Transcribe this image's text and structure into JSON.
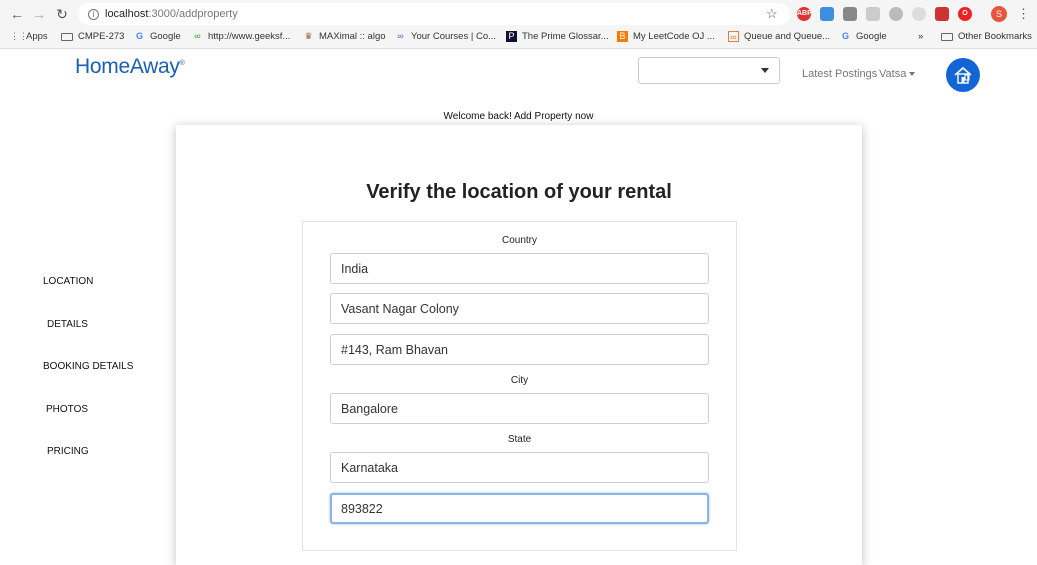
{
  "browser": {
    "url_host": "localhost",
    "url_path": ":3000/addproperty",
    "profile_initial": "S"
  },
  "bookmarks": [
    {
      "label": "Apps"
    },
    {
      "label": "CMPE-273"
    },
    {
      "label": "Google"
    },
    {
      "label": "http://www.geeksf..."
    },
    {
      "label": "MAXimal :: algo"
    },
    {
      "label": "Your Courses | Co..."
    },
    {
      "label": "The Prime Glossar..."
    },
    {
      "label": "My LeetCode OJ ..."
    },
    {
      "label": "Queue and Queue..."
    },
    {
      "label": "Google"
    },
    {
      "label": "Other Bookmarks"
    }
  ],
  "navbar": {
    "brand": "HomeAway",
    "brand_mark": "®",
    "select_value": "",
    "latest_postings": "Latest Postings",
    "user_name": "Vatsa"
  },
  "welcome": "Welcome back! Add Property now",
  "sidebar": {
    "items": [
      {
        "label": "LOCATION"
      },
      {
        "label": "DETAILS"
      },
      {
        "label": "BOOKING DETAILS"
      },
      {
        "label": "PHOTOS"
      },
      {
        "label": "PRICING"
      }
    ]
  },
  "form": {
    "title": "Verify the location of your rental",
    "country_label": "Country",
    "country": "India",
    "street": "Vasant Nagar Colony",
    "unit": "#143, Ram Bhavan",
    "city_label": "City",
    "city": "Bangalore",
    "state_label": "State",
    "state": "Karnataka",
    "zip": "893822"
  },
  "colors": {
    "brand": "#1a5fb4",
    "logo_bg": "#1365d6",
    "focus_border": "#8ab6e6"
  }
}
